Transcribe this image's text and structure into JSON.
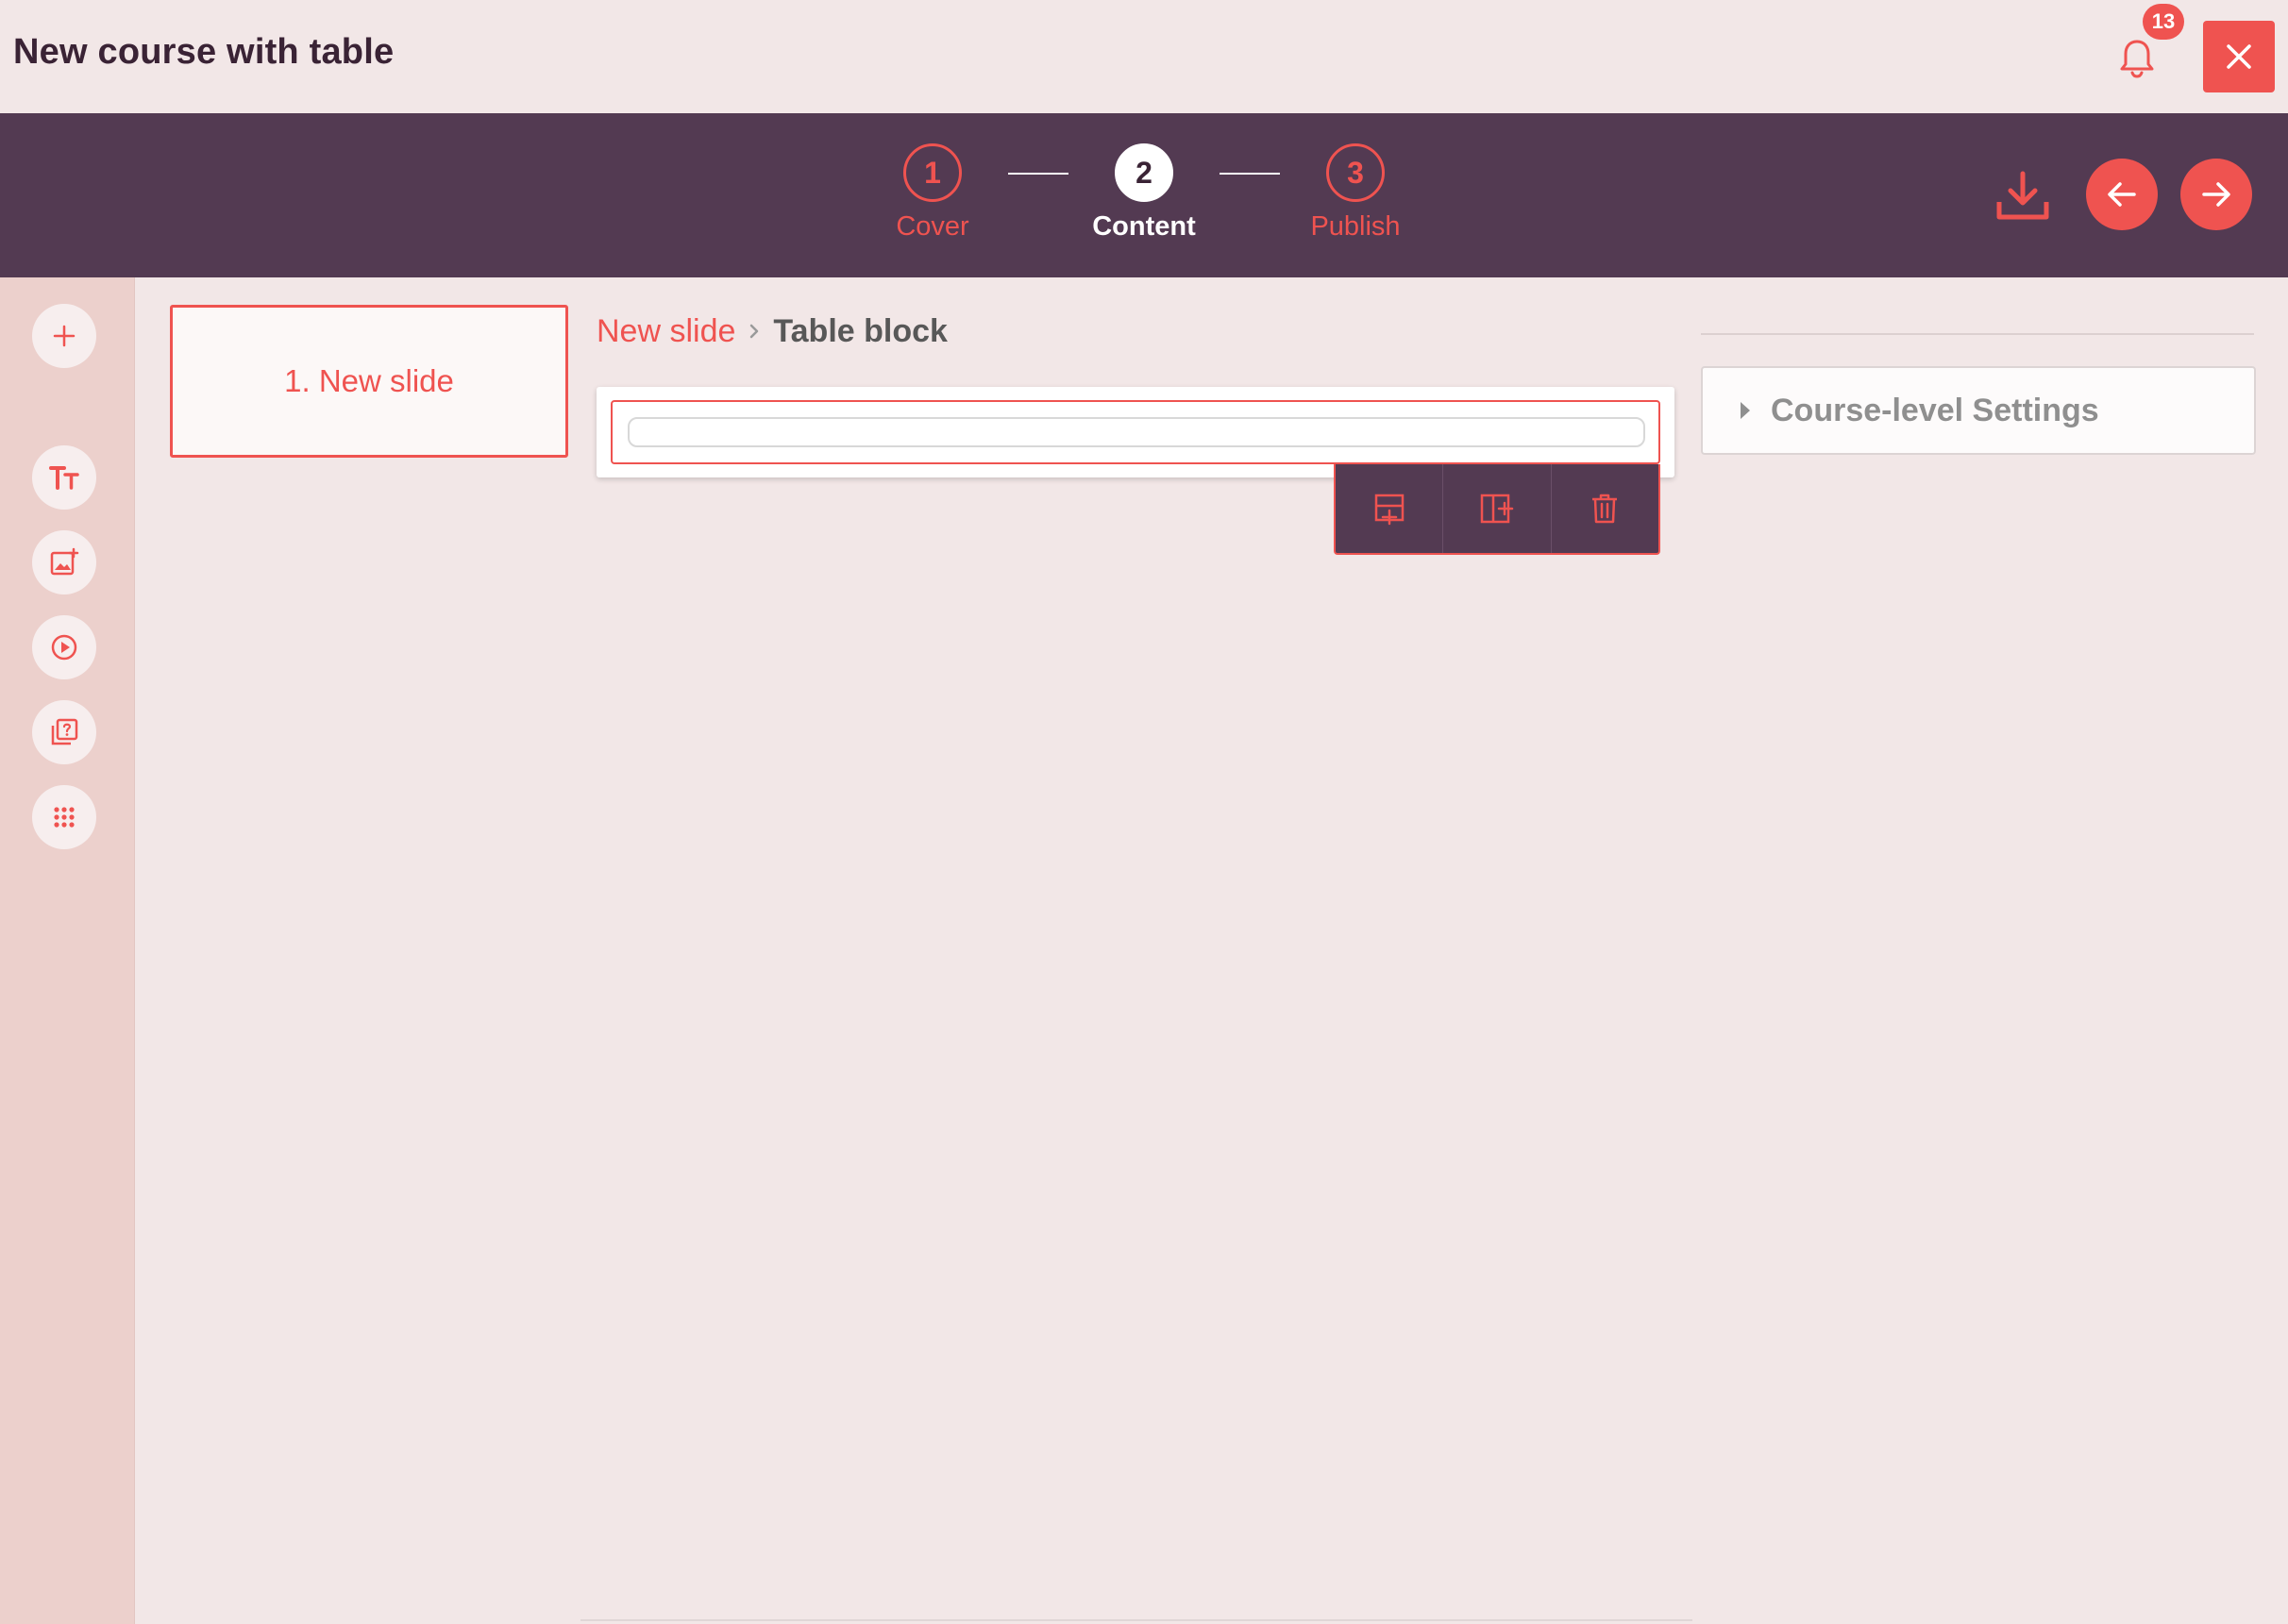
{
  "app": {
    "title": "New course with table",
    "notifications_count": "13"
  },
  "stepper": {
    "steps": [
      {
        "number": "1",
        "label": "Cover",
        "state": "done"
      },
      {
        "number": "2",
        "label": "Content",
        "state": "active"
      },
      {
        "number": "3",
        "label": "Publish",
        "state": "pending"
      }
    ]
  },
  "sidebar": {
    "tools": [
      {
        "icon": "plus-icon"
      },
      {
        "icon": "text-icon"
      },
      {
        "icon": "image-icon"
      },
      {
        "icon": "video-play-icon"
      },
      {
        "icon": "quiz-icon"
      },
      {
        "icon": "more-blocks-icon"
      }
    ]
  },
  "slides": [
    {
      "label": "1. New slide"
    }
  ],
  "editor": {
    "breadcrumb": {
      "parent": "New slide",
      "current": "Table block"
    },
    "block_toolbar": {
      "icons": [
        "add-row-icon",
        "add-column-icon",
        "delete-icon"
      ]
    }
  },
  "settings": {
    "course_level_label": "Course-level Settings"
  },
  "colors": {
    "accent": "#ef5350",
    "header_bg": "#533a52",
    "page_bg": "#f2e7e7",
    "sidebar_bg": "#ecd0cc"
  }
}
